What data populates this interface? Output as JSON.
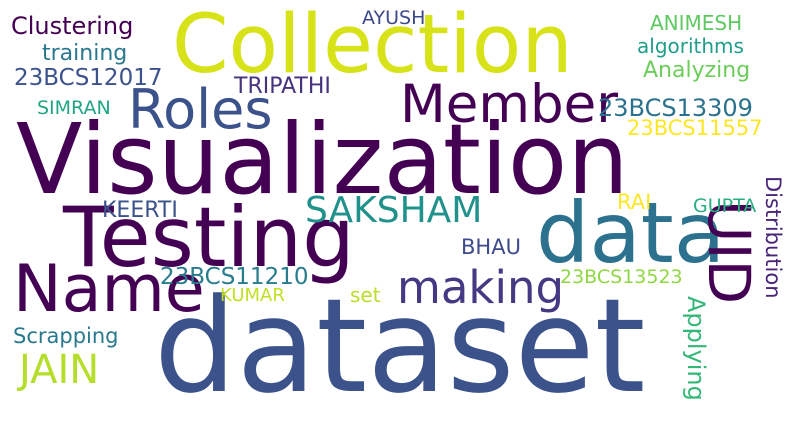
{
  "words": {
    "visualization": {
      "text": "Visualization",
      "color": "#440154"
    },
    "dataset": {
      "text": "dataset",
      "color": "#3b528b"
    },
    "collection": {
      "text": "Collection",
      "color": "#d8e219"
    },
    "testing": {
      "text": "Testing",
      "color": "#440154"
    },
    "data": {
      "text": "data",
      "color": "#2c728e"
    },
    "name": {
      "text": "Name",
      "color": "#440154"
    },
    "roles": {
      "text": "Roles",
      "color": "#3b528b"
    },
    "member": {
      "text": "Member",
      "color": "#440154"
    },
    "uid": {
      "text": "UID",
      "color": "#440154"
    },
    "making": {
      "text": "making",
      "color": "#443983"
    },
    "saksham": {
      "text": "SAKSHAM",
      "color": "#21918c"
    },
    "jain": {
      "text": "JAIN",
      "color": "#b5de2b"
    },
    "clustering": {
      "text": "Clustering",
      "color": "#440154"
    },
    "training": {
      "text": "training",
      "color": "#2a788e"
    },
    "id_12017": {
      "text": "23BCS12017",
      "color": "#3b528b"
    },
    "simran": {
      "text": "SIMRAN",
      "color": "#21a585"
    },
    "tripathi": {
      "text": "TRIPATHI",
      "color": "#46327e"
    },
    "ayush": {
      "text": "AYUSH",
      "color": "#3e4989"
    },
    "animesh": {
      "text": "ANIMESH",
      "color": "#5ec962"
    },
    "algorithms": {
      "text": "algorithms",
      "color": "#1f9e89"
    },
    "analyzing": {
      "text": "Analyzing",
      "color": "#6ccd5a"
    },
    "id_13309": {
      "text": "23BCS13309",
      "color": "#2c728e"
    },
    "id_11557": {
      "text": "23BCS11557",
      "color": "#fde725"
    },
    "keerti": {
      "text": "KEERTI",
      "color": "#3b528b"
    },
    "rai": {
      "text": "RAI",
      "color": "#fde725"
    },
    "gupta": {
      "text": "GUPTA",
      "color": "#28ae80"
    },
    "bhau": {
      "text": "BHAU",
      "color": "#3e4a89"
    },
    "id_11210": {
      "text": "23BCS11210",
      "color": "#287c8e"
    },
    "kumar": {
      "text": "KUMAR",
      "color": "#c2df23"
    },
    "set": {
      "text": "set",
      "color": "#b8de29"
    },
    "id_13523": {
      "text": "23BCS13523",
      "color": "#8fd744"
    },
    "scrapping": {
      "text": "Scrapping",
      "color": "#2a788e"
    },
    "applying": {
      "text": "Applying",
      "color": "#35b779"
    },
    "distribution": {
      "text": "Distribution",
      "color": "#482576"
    }
  }
}
